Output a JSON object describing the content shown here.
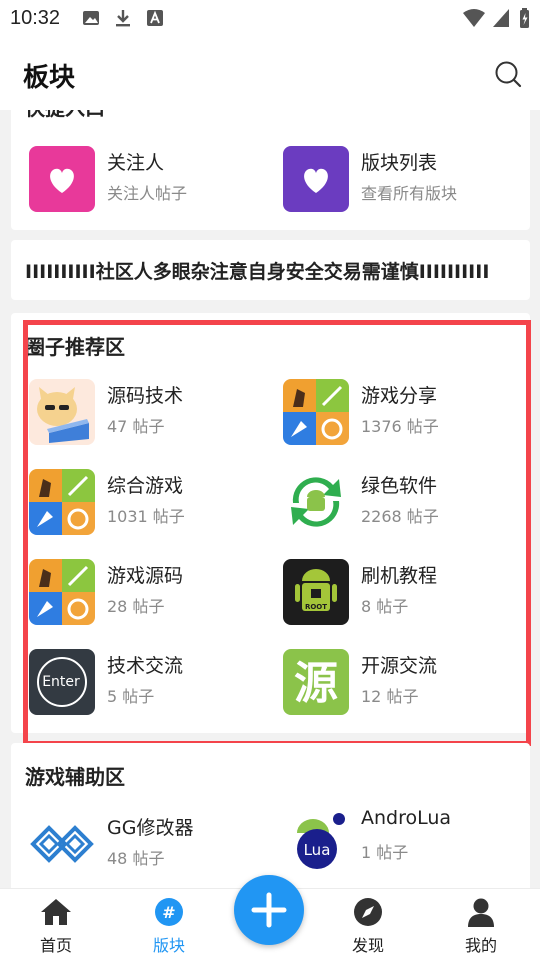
{
  "status_bar": {
    "time": "10:32"
  },
  "app_bar": {
    "title": "板块"
  },
  "quick_entry": {
    "title": "快捷入口",
    "items": [
      {
        "name": "关注人",
        "sub": "关注人帖子",
        "color": "#e8399a",
        "icon": "heart-icon"
      },
      {
        "name": "版块列表",
        "sub": "查看所有版块",
        "color": "#6b3cc0",
        "icon": "heart-icon"
      }
    ]
  },
  "notice": {
    "text": "IIIIIIIIII社区人多眼杂注意自身安全交易需谨慎IIIIIIIIII"
  },
  "circle_section": {
    "title": "圈子推荐区",
    "items": [
      {
        "name": "源码技术",
        "sub": "47 帖子",
        "icon": "cat-laptop-icon"
      },
      {
        "name": "游戏分享",
        "sub": "1376 帖子",
        "icon": "game-center-icon"
      },
      {
        "name": "综合游戏",
        "sub": "1031 帖子",
        "icon": "game-center-icon"
      },
      {
        "name": "绿色软件",
        "sub": "2268 帖子",
        "icon": "android-recycle-icon"
      },
      {
        "name": "游戏源码",
        "sub": "28 帖子",
        "icon": "game-center-icon"
      },
      {
        "name": "刷机教程",
        "sub": "8 帖子",
        "icon": "android-root-icon"
      },
      {
        "name": "技术交流",
        "sub": "5 帖子",
        "icon": "enter-logo-icon"
      },
      {
        "name": "开源交流",
        "sub": "12 帖子",
        "icon": "yuan-character-icon"
      }
    ],
    "enter_logo_text": "Enter",
    "root_text": "ROOT",
    "yuan_glyph": "源"
  },
  "game_assist": {
    "title": "游戏辅助区",
    "items": [
      {
        "name": "GG修改器",
        "sub": "48 帖子",
        "icon": "gg-logo-icon"
      },
      {
        "name": "AndroLua",
        "sub": "1 帖子",
        "icon": "androlua-icon"
      }
    ],
    "lua_text": "Lua"
  },
  "bottom_nav": {
    "items": [
      {
        "label": "首页",
        "icon": "home-icon"
      },
      {
        "label": "版块",
        "icon": "hashtag-icon",
        "active": true
      },
      {
        "label": "发现",
        "icon": "compass-icon"
      },
      {
        "label": "我的",
        "icon": "person-icon"
      }
    ],
    "fab_icon": "plus-icon"
  },
  "colors": {
    "accent": "#2196f3",
    "highlight": "#f4444b"
  }
}
